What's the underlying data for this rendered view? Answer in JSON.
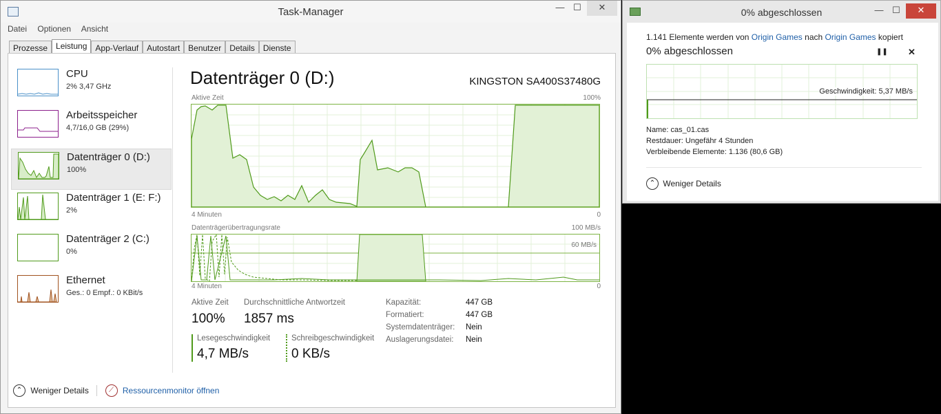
{
  "taskmanager": {
    "title": "Task-Manager",
    "window_buttons": {
      "minimize": "—",
      "maximize": "☐",
      "close": "✕"
    },
    "menu": [
      "Datei",
      "Optionen",
      "Ansicht"
    ],
    "tabs": [
      "Prozesse",
      "Leistung",
      "App-Verlauf",
      "Autostart",
      "Benutzer",
      "Details",
      "Dienste"
    ],
    "active_tab": "Leistung",
    "sidebar": [
      {
        "title": "CPU",
        "sub": "2%  3,47 GHz",
        "color": "#4a90c8"
      },
      {
        "title": "Arbeitsspeicher",
        "sub": "4,7/16,0 GB (29%)",
        "color": "#8b1e8b"
      },
      {
        "title": "Datenträger 0 (D:)",
        "sub": "100%",
        "color": "#4f9a1a"
      },
      {
        "title": "Datenträger 1 (E: F:)",
        "sub": "2%",
        "color": "#4f9a1a"
      },
      {
        "title": "Datenträger 2 (C:)",
        "sub": "0%",
        "color": "#4f9a1a"
      },
      {
        "title": "Ethernet",
        "sub": "Ges.: 0  Empf.: 0 KBit/s",
        "color": "#a0521e"
      }
    ],
    "main": {
      "title": "Datenträger 0 (D:)",
      "model": "KINGSTON SA400S37480G",
      "graph1": {
        "label": "Aktive Zeit",
        "max": "100%",
        "time": "4 Minuten",
        "min": "0"
      },
      "graph2": {
        "label": "Datenträgerübertragungsrate",
        "max": "100 MB/s",
        "mid": "60 MB/s",
        "time": "4 Minuten",
        "min": "0"
      },
      "stats": {
        "active_label": "Aktive Zeit",
        "active_value": "100%",
        "resp_label": "Durchschnittliche Antwortzeit",
        "resp_value": "1857 ms",
        "read_label": "Lesegeschwindigkeit",
        "read_value": "4,7 MB/s",
        "write_label": "Schreibgeschwindigkeit",
        "write_value": "0 KB/s"
      },
      "properties": [
        {
          "label": "Kapazität:",
          "value": "447 GB"
        },
        {
          "label": "Formatiert:",
          "value": "447 GB"
        },
        {
          "label": "Systemdatenträger:",
          "value": "Nein"
        },
        {
          "label": "Auslagerungsdatei:",
          "value": "Nein"
        }
      ]
    },
    "bottom": {
      "less_details": "Weniger Details",
      "resource_monitor": "Ressourcenmonitor öffnen"
    }
  },
  "copy_dialog": {
    "title": "0% abgeschlossen",
    "window_buttons": {
      "minimize": "—",
      "maximize": "☐",
      "close": "✕"
    },
    "line1_pre": "1.141 Elemente werden von",
    "source": "Origin Games",
    "line1_mid": "nach",
    "target": "Origin Games",
    "line1_post": "kopiert",
    "progress_text": "0% abgeschlossen",
    "pause_icon": "❚❚",
    "cancel_icon": "✕",
    "speed": "Geschwindigkeit: 5,37 MB/s",
    "name_label": "Name:",
    "name_value": "cas_01.cas",
    "remaining_label": "Restdauer:",
    "remaining_value": "Ungefähr 4 Stunden",
    "items_label": "Verbleibende Elemente:",
    "items_value": "1.136 (80,6 GB)",
    "less_details": "Weniger Details"
  }
}
